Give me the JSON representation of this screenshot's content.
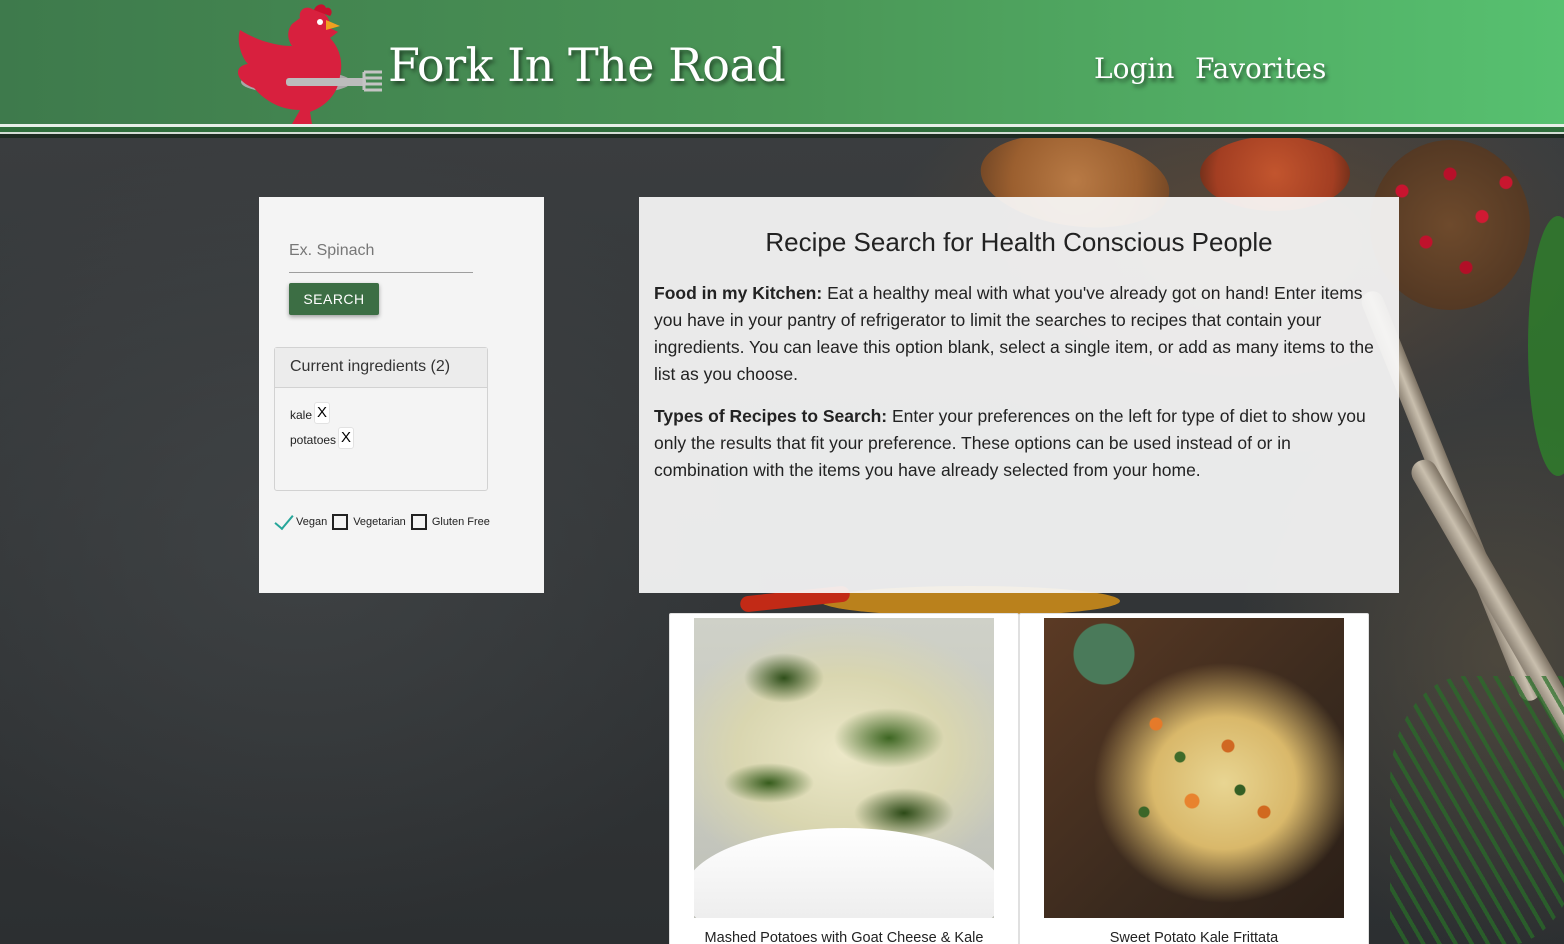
{
  "header": {
    "brand": "Fork In The Road",
    "nav": {
      "login": "Login",
      "favorites": "Favorites"
    }
  },
  "search": {
    "placeholder": "Ex. Spinach",
    "value": "",
    "button_label": "SEARCH"
  },
  "ingredients": {
    "heading": "Current ingredients (2)",
    "items": [
      {
        "name": "kale",
        "remove": "X"
      },
      {
        "name": "potatoes",
        "remove": "X"
      }
    ]
  },
  "filters": [
    {
      "label": "Vegan",
      "checked": true
    },
    {
      "label": "Vegetarian",
      "checked": false
    },
    {
      "label": "Gluten Free",
      "checked": false
    }
  ],
  "intro": {
    "title": "Recipe Search for Health Conscious People",
    "p1_heading": "Food in my Kitchen:",
    "p1_text": " Eat a healthy meal with what you've already got on hand! Enter items you have in your pantry of refrigerator to limit the searches to recipes that contain your ingredients. You can leave this option blank, select a single item, or add as many items to the list as you choose.",
    "p2_heading": "Types of Recipes to Search:",
    "p2_text": " Enter your preferences on the left for type of diet to show you only the results that fit your preference. These options can be used instead of or in combination with the items you have already selected from your home."
  },
  "results": [
    {
      "title": "Mashed Potatoes with Goat Cheese & Kale"
    },
    {
      "title": "Sweet Potato Kale Frittata"
    }
  ],
  "colors": {
    "header_start": "#3e7a4c",
    "header_end": "#57c170",
    "button": "#3c6e44",
    "check": "#26a69a"
  }
}
